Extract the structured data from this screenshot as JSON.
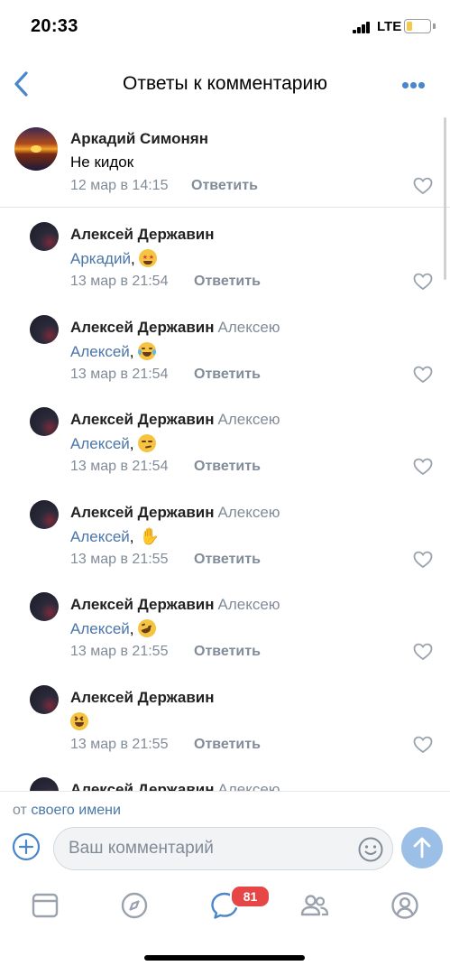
{
  "status_bar": {
    "time": "20:33",
    "network": "LTE",
    "battery_level": 0.2
  },
  "nav": {
    "title": "Ответы к комментарию",
    "back_icon": "chevron-left-icon",
    "more_icon": "more-dots-icon"
  },
  "root_comment": {
    "author": "Аркадий Симонян",
    "text": "Не кидок",
    "date": "12 мар в 14:15",
    "reply_label": "Ответить"
  },
  "replies": [
    {
      "author": "Алексей Державин",
      "addressee": "",
      "mention": "Аркадий",
      "emoji": "star-struck-emoji",
      "date": "13 мар в 21:54",
      "reply_label": "Ответить"
    },
    {
      "author": "Алексей Державин",
      "addressee": "Алексею",
      "mention": "Алексей",
      "emoji": "tears-of-joy-emoji",
      "date": "13 мар в 21:54",
      "reply_label": "Ответить"
    },
    {
      "author": "Алексей Державин",
      "addressee": "Алексею",
      "mention": "Алексей",
      "emoji": "smirk-emoji",
      "date": "13 мар в 21:54",
      "reply_label": "Ответить"
    },
    {
      "author": "Алексей Державин",
      "addressee": "Алексею",
      "mention": "Алексей",
      "emoji": "waving-hand-emoji",
      "date": "13 мар в 21:55",
      "reply_label": "Ответить"
    },
    {
      "author": "Алексей Державин",
      "addressee": "Алексею",
      "mention": "Алексей",
      "emoji": "rofl-emoji",
      "date": "13 мар в 21:55",
      "reply_label": "Ответить"
    },
    {
      "author": "Алексей Державин",
      "addressee": "",
      "mention": "",
      "emoji": "grinning-squint-emoji",
      "date": "13 мар в 21:55",
      "reply_label": "Ответить"
    },
    {
      "author": "Алексей Державин",
      "addressee": "Алексею",
      "mention": "",
      "emoji": "",
      "date": "",
      "reply_label": ""
    }
  ],
  "composer": {
    "from_prefix": "от",
    "from_link": "своего имени",
    "placeholder": "Ваш комментарий",
    "add_icon": "plus-circle-icon",
    "emoji_icon": "smile-icon",
    "send_icon": "arrow-up-icon"
  },
  "tab_bar": {
    "tabs": [
      "news-icon",
      "discover-icon",
      "messages-icon",
      "friends-icon",
      "profile-icon"
    ],
    "messages_badge": "81"
  },
  "colors": {
    "accent": "#4986cc",
    "link": "#4a76a8",
    "secondary": "#818c99",
    "badge": "#e64646",
    "send_disabled": "#9cbfe8"
  }
}
